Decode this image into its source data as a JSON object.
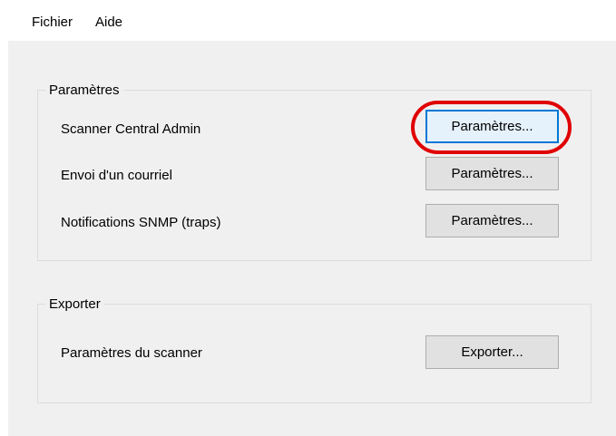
{
  "menubar": {
    "items": [
      "Fichier",
      "Aide"
    ]
  },
  "settings_group": {
    "title": "Paramètres",
    "rows": [
      {
        "label": "Scanner Central Admin",
        "button": "Paramètres..."
      },
      {
        "label": "Envoi d'un courriel",
        "button": "Paramètres..."
      },
      {
        "label": "Notifications SNMP (traps)",
        "button": "Paramètres..."
      }
    ]
  },
  "export_group": {
    "title": "Exporter",
    "rows": [
      {
        "label": "Paramètres du scanner",
        "button": "Exporter..."
      }
    ]
  },
  "colors": {
    "highlight": "#e00000",
    "focus": "#0078d7",
    "window_bg": "#f0f0f0"
  }
}
